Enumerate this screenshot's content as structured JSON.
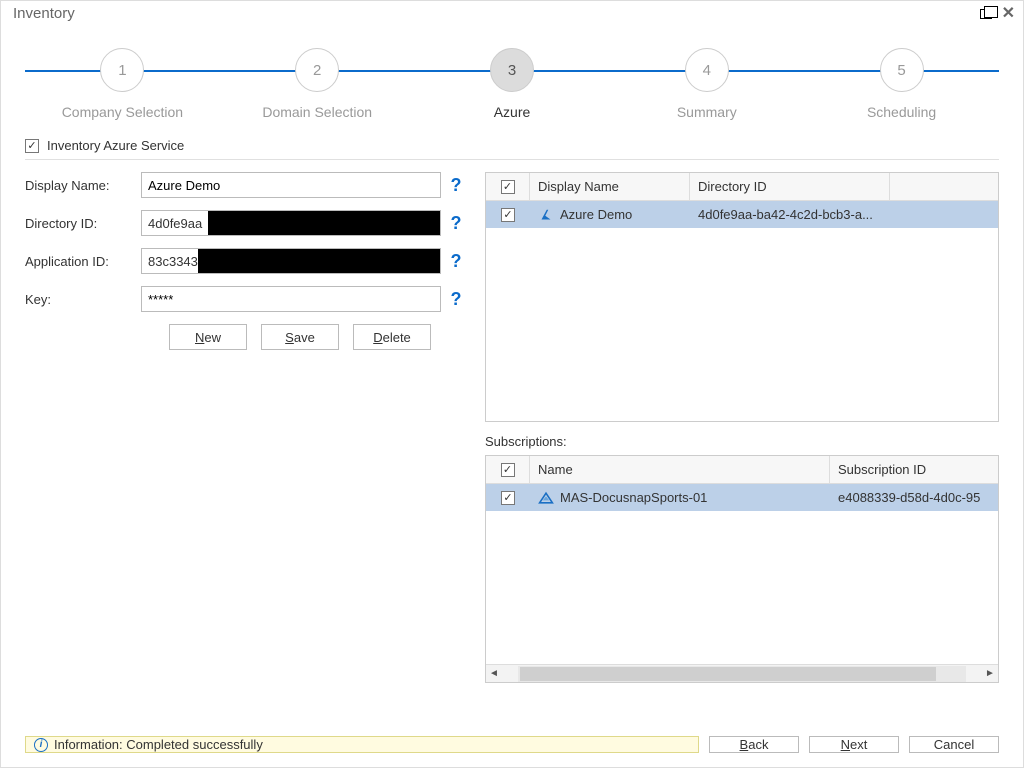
{
  "window": {
    "title": "Inventory"
  },
  "steps": [
    {
      "num": "1",
      "label": "Company Selection"
    },
    {
      "num": "2",
      "label": "Domain Selection"
    },
    {
      "num": "3",
      "label": "Azure"
    },
    {
      "num": "4",
      "label": "Summary"
    },
    {
      "num": "5",
      "label": "Scheduling"
    }
  ],
  "service_checkbox_label": "Inventory Azure Service",
  "form": {
    "display_name_label": "Display Name:",
    "display_name_value": "Azure Demo",
    "directory_id_label": "Directory ID:",
    "directory_id_visible_prefix": "4d0fe9aa",
    "application_id_label": "Application ID:",
    "application_id_visible_prefix": "83c3343",
    "key_label": "Key:",
    "key_value": "*****"
  },
  "buttons": {
    "new": "New",
    "save": "Save",
    "delete": "Delete"
  },
  "dir_grid": {
    "headers": {
      "display_name": "Display Name",
      "directory_id": "Directory ID"
    },
    "rows": [
      {
        "checked": true,
        "display_name": "Azure Demo",
        "directory_id": "4d0fe9aa-ba42-4c2d-bcb3-a..."
      }
    ]
  },
  "subscriptions_label": "Subscriptions:",
  "subs_grid": {
    "headers": {
      "name": "Name",
      "subscription_id": "Subscription ID"
    },
    "rows": [
      {
        "checked": true,
        "name": "MAS-DocusnapSports-01",
        "subscription_id": "e4088339-d58d-4d0c-95"
      }
    ]
  },
  "status": {
    "text": "Information: Completed successfully"
  },
  "nav": {
    "back": "Back",
    "next": "Next",
    "cancel": "Cancel"
  }
}
